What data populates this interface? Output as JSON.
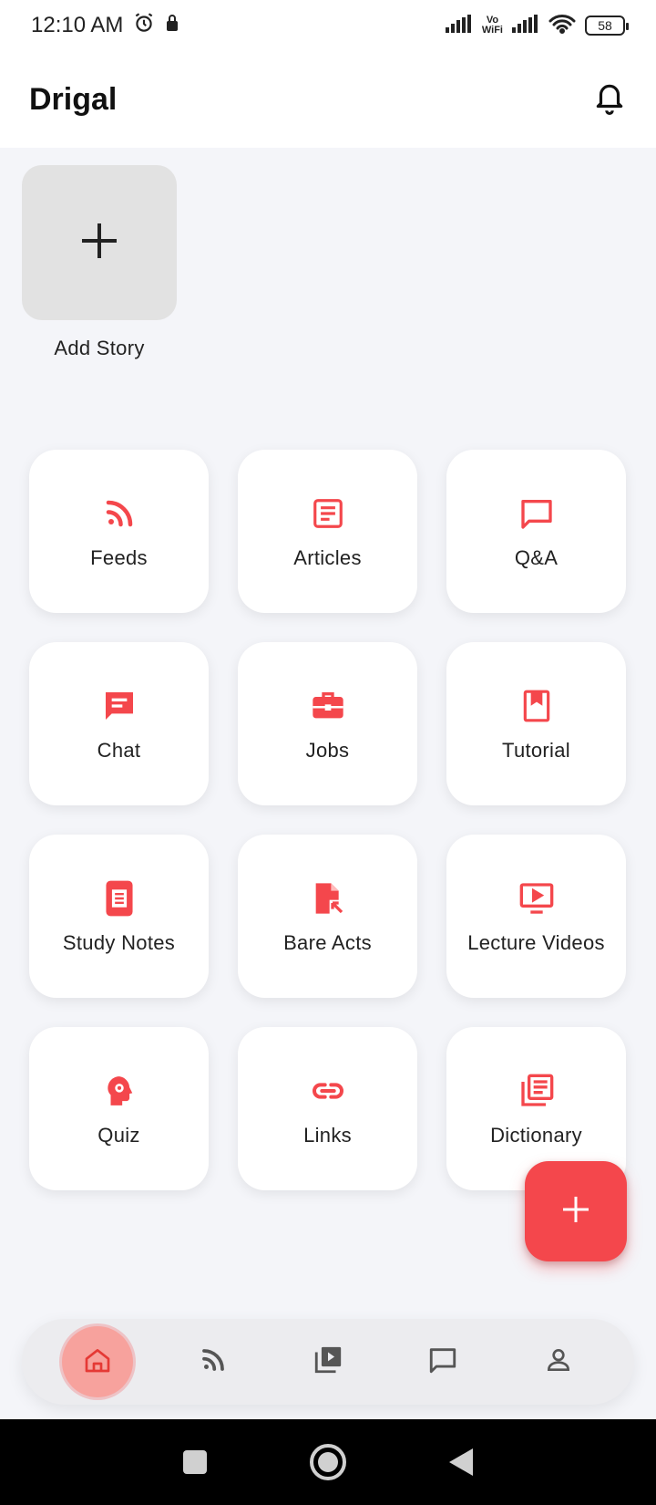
{
  "status_bar": {
    "time": "12:10 AM",
    "vowifi_line1": "Vo",
    "vowifi_line2": "WiFi",
    "battery": "58"
  },
  "app_bar": {
    "title": "Drigal"
  },
  "story": {
    "label": "Add Story"
  },
  "tiles": [
    {
      "label": "Feeds",
      "icon": "rss-icon"
    },
    {
      "label": "Articles",
      "icon": "article-icon"
    },
    {
      "label": "Q&A",
      "icon": "chat-bubble-outline-icon"
    },
    {
      "label": "Chat",
      "icon": "chat-message-icon"
    },
    {
      "label": "Jobs",
      "icon": "briefcase-icon"
    },
    {
      "label": "Tutorial",
      "icon": "book-icon"
    },
    {
      "label": "Study Notes",
      "icon": "notes-phone-icon"
    },
    {
      "label": "Bare Acts",
      "icon": "document-arrow-icon"
    },
    {
      "label": "Lecture Videos",
      "icon": "video-player-icon"
    },
    {
      "label": "Quiz",
      "icon": "head-gear-icon"
    },
    {
      "label": "Links",
      "icon": "link-icon"
    },
    {
      "label": "Dictionary",
      "icon": "library-books-icon"
    }
  ],
  "bottom_nav": [
    {
      "icon": "home-icon",
      "active": true
    },
    {
      "icon": "rss-icon",
      "active": false
    },
    {
      "icon": "video-library-icon",
      "active": false
    },
    {
      "icon": "chat-icon",
      "active": false
    },
    {
      "icon": "person-icon",
      "active": false
    }
  ],
  "colors": {
    "accent": "#f4474c",
    "background": "#f4f5f9",
    "tile": "#ffffff"
  }
}
